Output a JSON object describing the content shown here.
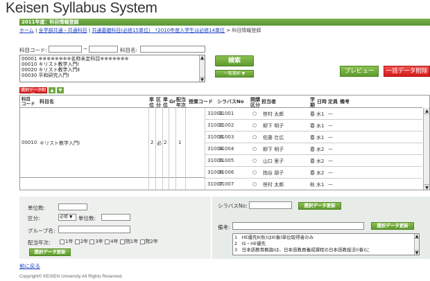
{
  "app_title": "Keisen Syllabus System",
  "section_title": "2011年度：科目情報登録",
  "breadcrumb": {
    "home": "ホーム",
    "sep1": " | ",
    "item1": "全学部共通・共通科目",
    "sep2": " | ",
    "item2": "共通基礎科目(必修15単位)　*2010年度入学生は必修14単位",
    "sep3": " > ",
    "current": "科目情報登録"
  },
  "search": {
    "code_label": "科目コード:",
    "range_sep": "~",
    "name_label": "科目名:",
    "list": [
      "00001  ※※※※※※※※名称未定科目※※※※※※※",
      "00010  キリスト教学入門Ⅰ",
      "00020  キリスト教学入門Ⅱ",
      "00030  平和研究入門Ⅰ"
    ],
    "search_button": "検索",
    "select_all_button": "一覧選択 ▼"
  },
  "actions": {
    "preview": "プレビュー",
    "bulk_delete": "一括データ削除",
    "delete_selected": "選択データ削除",
    "up_icon": "▲",
    "down_icon": "▼"
  },
  "table": {
    "headers": {
      "code": "科目\nコード",
      "name": "科目名",
      "unit": "単\n位",
      "kubun": "区\n分",
      "tanni": "単\n位",
      "gr": "Gr",
      "haitou": "配当\n年次",
      "jugyo": "授業コード",
      "syllabus": "シラバスNo",
      "kaikou": "開講\n区分",
      "tantou": "担当者",
      "gakki": "学\n期",
      "nichiji": "日時",
      "teiin": "定員",
      "biko": "備考"
    },
    "group": {
      "code": "00010",
      "name": "キリスト教学入門Ⅰ",
      "unit": "2",
      "kubun": "必",
      "tanni": "2",
      "haitou": "1"
    },
    "rows": [
      {
        "jugyo": "31001",
        "syllabus": "31001",
        "kaikou": "○",
        "tantou": "笹村 太郎",
        "gakki": "春",
        "nichiji": "水1",
        "teiin": "—"
      },
      {
        "jugyo": "31002",
        "syllabus": "31002",
        "kaikou": "○",
        "tantou": "柳下 明子",
        "gakki": "春",
        "nichiji": "水1",
        "teiin": "—"
      },
      {
        "jugyo": "31003",
        "syllabus": "31003",
        "kaikou": "○",
        "tantou": "佐藤 壮広",
        "gakki": "春",
        "nichiji": "水1",
        "teiin": "—"
      },
      {
        "jugyo": "31004",
        "syllabus": "31004",
        "kaikou": "○",
        "tantou": "柳下 明子",
        "gakki": "春",
        "nichiji": "水2",
        "teiin": "—"
      },
      {
        "jugyo": "31005",
        "syllabus": "31005",
        "kaikou": "○",
        "tantou": "山口 里子",
        "gakki": "春",
        "nichiji": "水2",
        "teiin": "—"
      },
      {
        "jugyo": "31006",
        "syllabus": "31006",
        "kaikou": "○",
        "tantou": "指谷 朋子",
        "gakki": "春",
        "nichiji": "水2",
        "teiin": "—"
      },
      {
        "jugyo": "31007",
        "syllabus": "31007",
        "kaikou": "○",
        "tantou": "笹村 太郎",
        "gakki": "秋",
        "nichiji": "水1",
        "teiin": "—"
      }
    ]
  },
  "form": {
    "credits_label": "単位数:",
    "kubun_label": "区分:",
    "kubun_value": "必修 ▼",
    "unit_count_label": "単位数:",
    "group_label": "グループ名:",
    "year_label": "配当年次:",
    "years": [
      "1年",
      "2年",
      "3年",
      "4年",
      "院1年",
      "院2年"
    ],
    "update_button": "選択データ更新",
    "syllabus_label": "シラバスNo:",
    "syllabus_update": "選択データ更新",
    "biko_label": "備考:",
    "biko_update": "選択データ更新",
    "biko_list": [
      "1　HE優先Ⅱ(秋)はⅡ(春)単位取得者のみ",
      "2　IS・HE優先",
      "3　日本語教育概論Ⅰは、日本語教員養成課程の日本語教授法Ⅰ(春)に"
    ]
  },
  "footer": {
    "back_link": "前に戻る",
    "copyright": "Copyright© KEISEN University All Rights Reserved."
  }
}
